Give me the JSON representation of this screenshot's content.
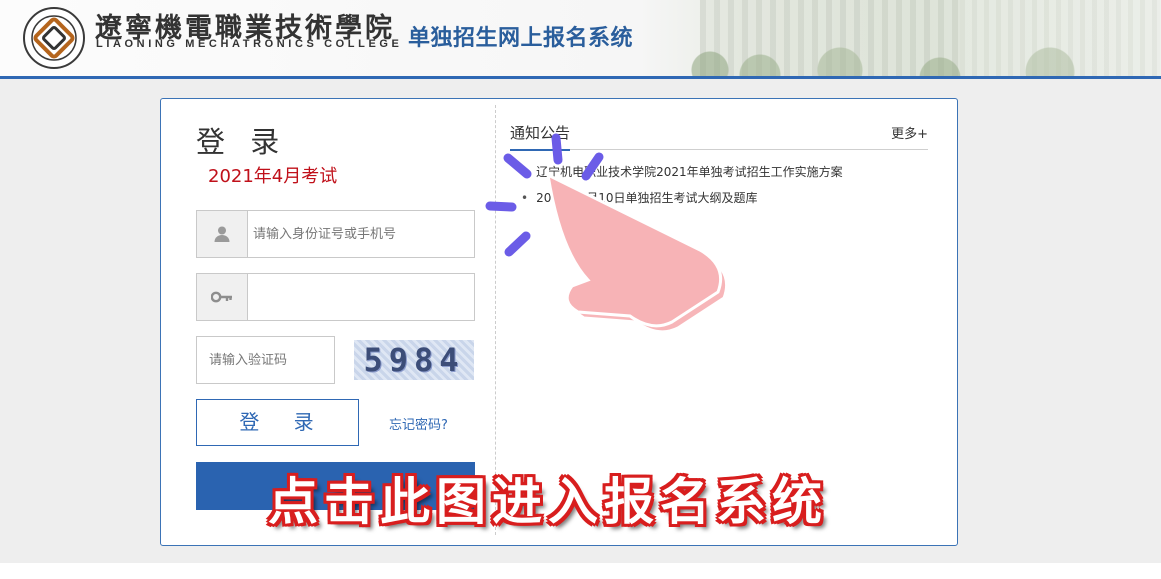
{
  "header": {
    "college_name_cn": "遼寧機電職業技術學院",
    "college_name_en": "LIAONING MECHATRONICS COLLEGE",
    "system_title": "单独招生网上报名系统"
  },
  "login": {
    "title": "登 录",
    "exam_label": "2021年4月考试",
    "username_placeholder": "请输入身份证号或手机号",
    "password_placeholder": "",
    "captcha_placeholder": "请输入验证码",
    "captcha_code": "5984",
    "login_button": "登 录",
    "forgot_password": "忘记密码?"
  },
  "notices": {
    "tab_label": "通知公告",
    "more_label": "更多+",
    "items": [
      "辽宁机电职业技术学院2021年单独考试招生工作实施方案",
      "2021年4月10日单独招生考试大纲及题库"
    ]
  },
  "overlay": {
    "banner_text": "点击此图进入报名系统"
  },
  "colors": {
    "brand_blue": "#2f68b4",
    "exam_red": "#c0101a",
    "hand_pink": "#f7b3b6",
    "spark_purple": "#6b5ce7"
  }
}
